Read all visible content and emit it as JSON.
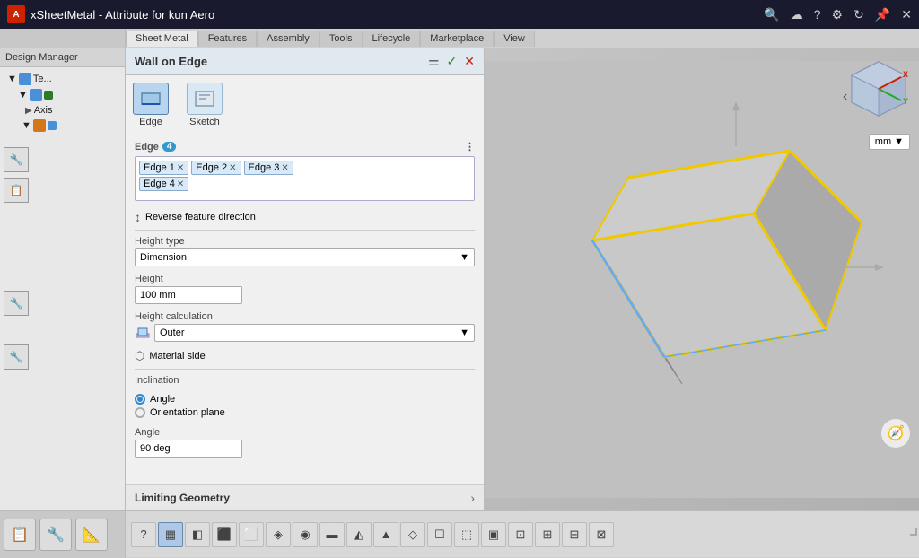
{
  "titleBar": {
    "appName": "xSheetMetal - Attribute for kun Aero",
    "appIcon": "A"
  },
  "panel": {
    "title": "Wall on Edge",
    "tabs": [
      {
        "id": "edge",
        "label": "Edge",
        "active": true
      },
      {
        "id": "sketch",
        "label": "Sketch",
        "active": false
      }
    ],
    "edgeSection": {
      "label": "Edge",
      "count": "4",
      "tags": [
        "Edge 1",
        "Edge 2",
        "Edge 3",
        "Edge 4"
      ]
    },
    "reverseBtn": "Reverse feature direction",
    "heightType": {
      "label": "Height type",
      "value": "Dimension"
    },
    "height": {
      "label": "Height",
      "value": "100 mm"
    },
    "heightCalculation": {
      "label": "Height calculation",
      "value": "Outer"
    },
    "materialSide": "Material side",
    "inclination": {
      "label": "Inclination",
      "options": [
        "Angle",
        "Orientation plane"
      ],
      "selected": "Angle"
    },
    "angle": {
      "label": "Angle",
      "value": "90 deg"
    },
    "limitingGeometry": "Limiting Geometry"
  },
  "viewport": {
    "unit": "mm",
    "navCube": {
      "xLabel": "X",
      "yLabel": "Y"
    }
  },
  "bottomTabs": [
    "Sheet Metal",
    "Features",
    "Assembly",
    "Tools",
    "Lifecycle",
    "Marketplace",
    "View"
  ],
  "activeTab": "Sheet Metal",
  "designManager": "Design Manager",
  "treeItems": [
    "Te...",
    "Axis"
  ]
}
